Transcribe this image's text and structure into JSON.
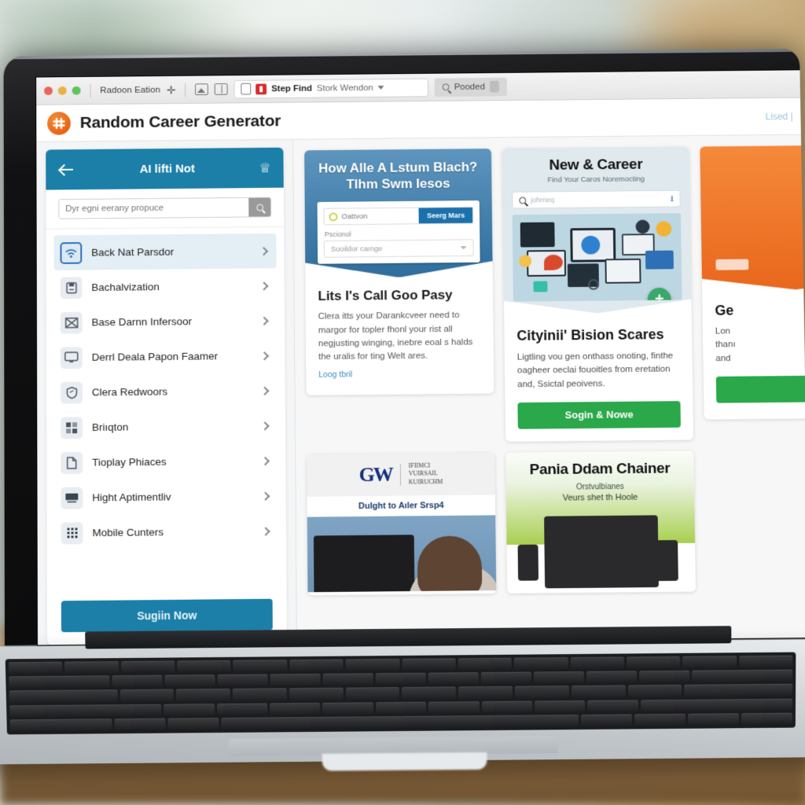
{
  "browser": {
    "window_controls": [
      "close",
      "minimize",
      "zoom"
    ],
    "profile_label": "Radoon Eation",
    "toolbar_icons": [
      "move-icon",
      "image-icon",
      "book-icon",
      "clipboard-icon"
    ],
    "omnibox": {
      "favicon": "red-square-favicon",
      "title": "Step Find",
      "suggestion": "Stork Wendon",
      "dropdown": "chevron-down-icon"
    },
    "search_chip": {
      "icon": "search-icon",
      "label": "Pooded"
    }
  },
  "app": {
    "logo": "hash-logo-icon",
    "title": "Random Career Generator",
    "header_right": "Lised |",
    "accent_color": "#1b7fa8",
    "brand_color": "#e8671a"
  },
  "sidebar": {
    "header": {
      "back_icon": "back-arrow-icon",
      "title": "AI lifti Not",
      "menu_icon": "crown-icon"
    },
    "search": {
      "placeholder": "Dyr egni eerany propuce",
      "button_icon": "search-icon"
    },
    "items": [
      {
        "label": "Back Nat Parsdor",
        "icon": "wifi-icon",
        "active": true
      },
      {
        "label": "Bachalvization",
        "icon": "save-disk-icon",
        "active": false
      },
      {
        "label": "Base Darnn Infersoor",
        "icon": "envelope-x-icon",
        "active": false
      },
      {
        "label": "Derrl Deala Papon Faamer",
        "icon": "monitor-icon",
        "active": false
      },
      {
        "label": "Clera Redwoors",
        "icon": "shield-icon",
        "active": false
      },
      {
        "label": "Briıqton",
        "icon": "grid-blocks-icon",
        "active": false
      },
      {
        "label": "Tioplay Phiaces",
        "icon": "document-icon",
        "active": false
      },
      {
        "label": "Hight Aptimentliv",
        "icon": "desktop-icon",
        "active": false
      },
      {
        "label": "Mobile Cunters",
        "icon": "keypad-icon",
        "active": false
      }
    ],
    "chevron_icon": "chevron-right-icon",
    "cta_label": "Sugiin Now"
  },
  "main": {
    "cards_row1": [
      {
        "id": "card-how-to",
        "header_title": "How Alle A Lstum Blach? Tlhm Swm Iesos",
        "form": {
          "input_icon": "circle-icon",
          "input_value": "Oattvon",
          "submit_label": "Seerg Mars",
          "field_label": "Pscionol",
          "select_value": "Suoildor caınge",
          "select_icon": "chevron-down-icon"
        },
        "body_title": "Lits I's Call Goo Pasy",
        "body_text": "Clera itts your Darankcveer need to margor for topler fhonl your rist all negjusting winging, inebre eoal s halds the uralis for ting Welt ares.",
        "link_label": "Loog tbril"
      },
      {
        "id": "card-new-career",
        "header_title": "New & Career",
        "header_sub": "Find Your Caros Noremocting",
        "search_placeholder": "johrrieq",
        "search_icon": "search-icon",
        "download_icon": "download-icon",
        "hero_alt": "devices-collage-illustration",
        "badge_icon": "plus-badge-icon",
        "body_title": "Cityinii' Bision Scares",
        "body_text": "Ligtling vou gen onthass onoting, finthe oagheer oeclai fouoitles from eretation and, Ssictal peoivens.",
        "cta_label": "Sogin & Nowe",
        "cta_color": "#2aa84a"
      },
      {
        "id": "card-partial-orange",
        "header_color": "#e9671d",
        "body_title": "Ge",
        "body_lines": [
          "Lon",
          "thanı",
          "and"
        ],
        "cta_color": "#2aa84a"
      }
    ],
    "cards_row2": [
      {
        "id": "card-gw",
        "logo_text": "GW",
        "logo_words": "IFIIMCI\nVUIRSAIL\nKUIRUCHM",
        "subtitle": "Dulght to Aıler Srsp4",
        "photo_alt": "man-at-laptop-photo"
      },
      {
        "id": "card-panla",
        "title": "Pania Ddam Chainer",
        "sub1": "Orstvulbianes",
        "sub2": "Veurs shet th Hoole",
        "photo_alt": "laptop-and-phones-illustration"
      }
    ]
  },
  "magnifier": {
    "name": "magnifying-glass-overlay",
    "lens_color": "#141416"
  }
}
